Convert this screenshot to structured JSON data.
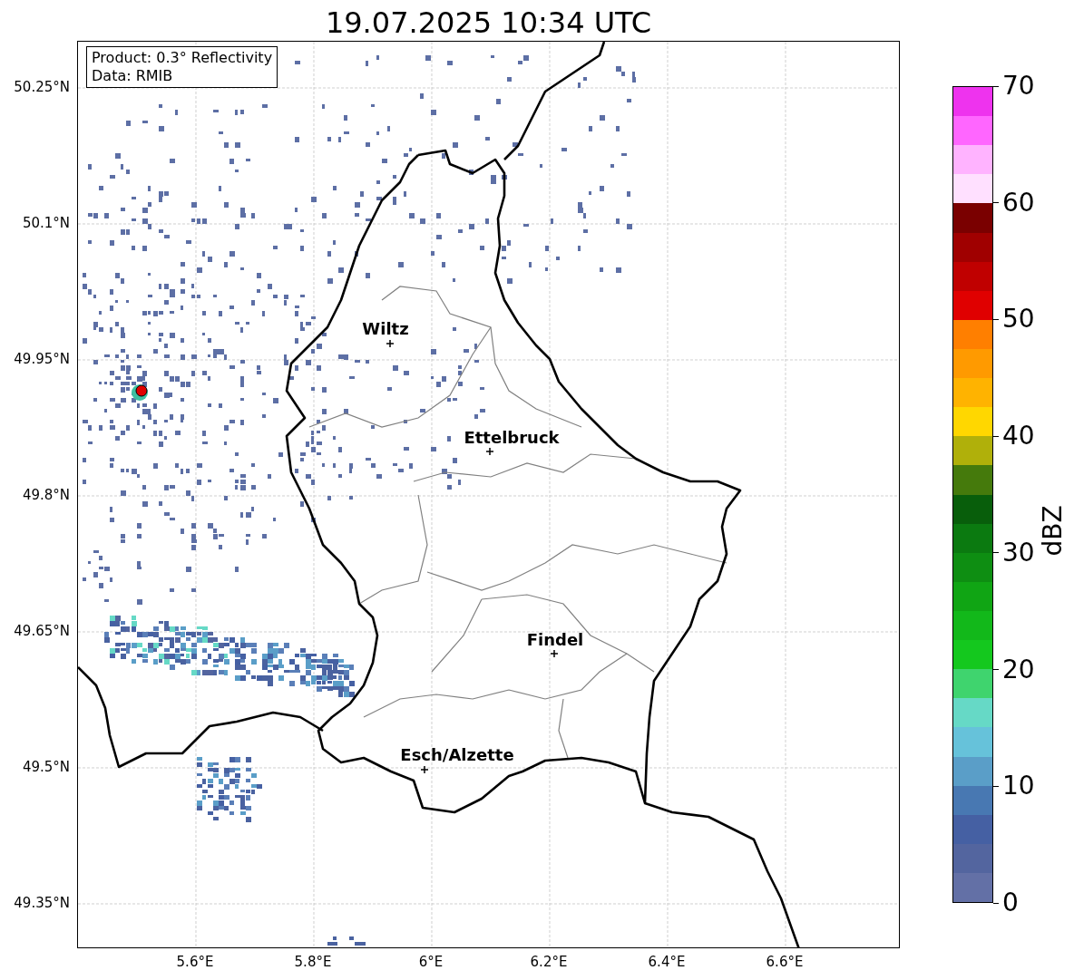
{
  "title": "19.07.2025 10:34 UTC",
  "legend": [
    "Product: 0.3° Reflectivity",
    "Data: RMIB"
  ],
  "map": {
    "lat_labels": [
      "50.25°N",
      "50.1°N",
      "49.95°N",
      "49.8°N",
      "49.65°N",
      "49.5°N",
      "49.35°N"
    ],
    "lon_labels": [
      "5.6°E",
      "5.8°E",
      "6°E",
      "6.2°E",
      "6.4°E",
      "6.6°E"
    ],
    "cities": [
      {
        "name": "Wiltz"
      },
      {
        "name": "Ettelbruck"
      },
      {
        "name": "Findel"
      },
      {
        "name": "Esch/Alzette"
      }
    ]
  },
  "colorbar": {
    "label": "dBZ",
    "ticks": [
      "70",
      "60",
      "50",
      "40",
      "30",
      "20",
      "10",
      "0"
    ],
    "bins": [
      {
        "color": "#ee33ee"
      },
      {
        "color": "#ff66ff"
      },
      {
        "color": "#ffb3ff"
      },
      {
        "color": "#ffe0ff"
      },
      {
        "color": "#7a0000"
      },
      {
        "color": "#a00000"
      },
      {
        "color": "#c00000"
      },
      {
        "color": "#e00000"
      },
      {
        "color": "#ff7f00"
      },
      {
        "color": "#ff9a00"
      },
      {
        "color": "#ffb300"
      },
      {
        "color": "#ffd700"
      },
      {
        "color": "#b0b00a"
      },
      {
        "color": "#457a0c"
      },
      {
        "color": "#085e0b"
      },
      {
        "color": "#0b7a10"
      },
      {
        "color": "#0e8e12"
      },
      {
        "color": "#10a514"
      },
      {
        "color": "#12b81a"
      },
      {
        "color": "#14c81e"
      },
      {
        "color": "#3fd46e"
      },
      {
        "color": "#66d9c6"
      },
      {
        "color": "#66c2da"
      },
      {
        "color": "#5a9ec8"
      },
      {
        "color": "#4878b2"
      },
      {
        "color": "#4560a3"
      },
      {
        "color": "#53659f"
      },
      {
        "color": "#6370a6"
      }
    ]
  }
}
